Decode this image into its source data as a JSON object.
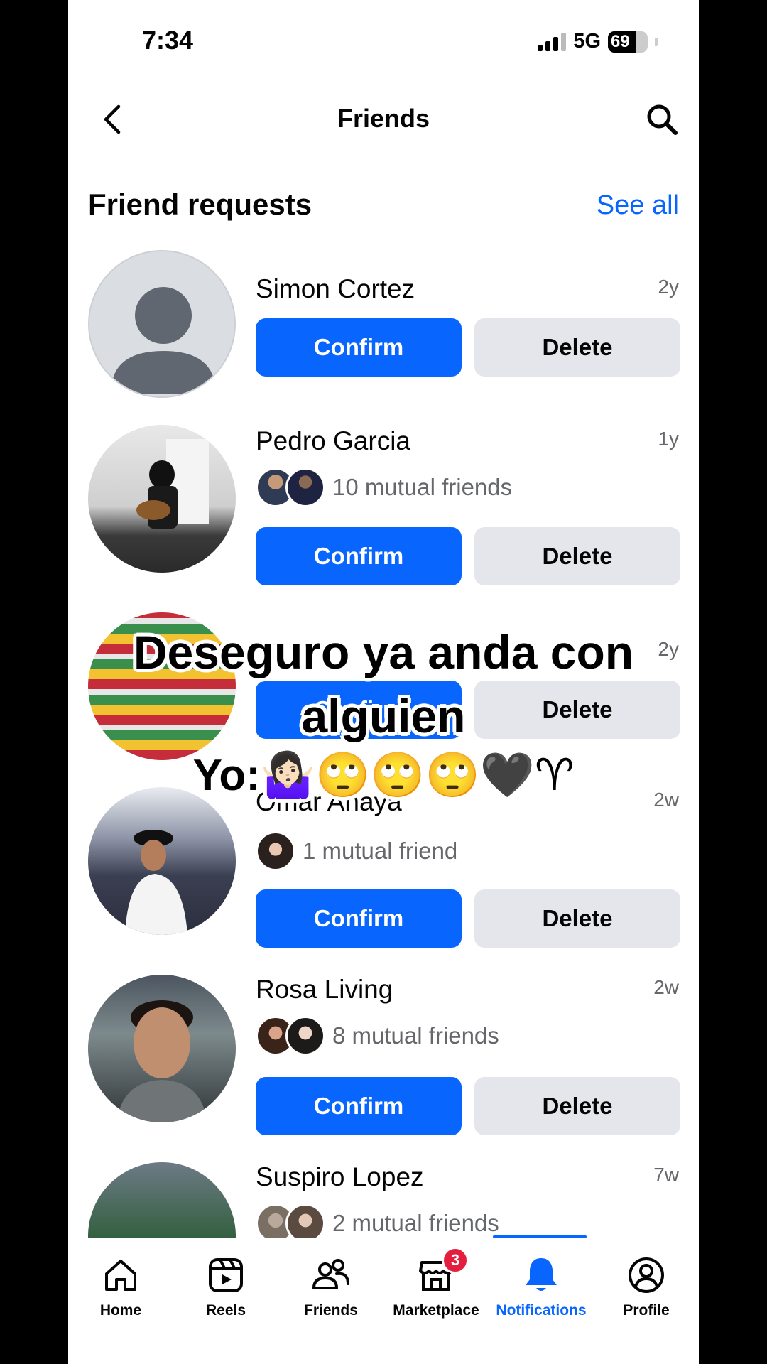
{
  "status_bar": {
    "time": "7:34",
    "network": "5G",
    "battery": "69",
    "battery_level": 0.69
  },
  "header": {
    "title": "Friends"
  },
  "section": {
    "title": "Friend requests",
    "see_all": "See all"
  },
  "requests": [
    {
      "name": "Simon Cortez",
      "time": "2y",
      "mutual": "",
      "confirm": "Confirm",
      "delete": "Delete"
    },
    {
      "name": "Pedro Garcia",
      "time": "1y",
      "mutual": "10 mutual friends",
      "confirm": "Confirm",
      "delete": "Delete"
    },
    {
      "name": "",
      "time": "2y",
      "mutual": "",
      "confirm": "Confirm",
      "delete": "Delete"
    },
    {
      "name": "Omar Anaya",
      "time": "2w",
      "mutual": "1 mutual friend",
      "confirm": "Confirm",
      "delete": "Delete"
    },
    {
      "name": "Rosa Living",
      "time": "2w",
      "mutual": "8 mutual friends",
      "confirm": "Confirm",
      "delete": "Delete"
    },
    {
      "name": "Suspiro Lopez",
      "time": "7w",
      "mutual": "2 mutual friends"
    }
  ],
  "overlay": {
    "line1": "Deseguro ya anda con",
    "line2": "alguien",
    "line3": "Yo:🤷🏻‍♀️🙄🙄🙄🖤♈"
  },
  "nav": {
    "items": [
      {
        "label": "Home",
        "icon": "home-icon"
      },
      {
        "label": "Reels",
        "icon": "reels-icon"
      },
      {
        "label": "Friends",
        "icon": "friends-icon"
      },
      {
        "label": "Marketplace",
        "icon": "marketplace-icon",
        "badge": "3"
      },
      {
        "label": "Notifications",
        "icon": "bell-icon"
      },
      {
        "label": "Profile",
        "icon": "profile-icon"
      }
    ],
    "active": "Notifications"
  },
  "colors": {
    "accent": "#0866ff",
    "delete_bg": "#e4e6eb",
    "badge": "#e41e3f"
  }
}
